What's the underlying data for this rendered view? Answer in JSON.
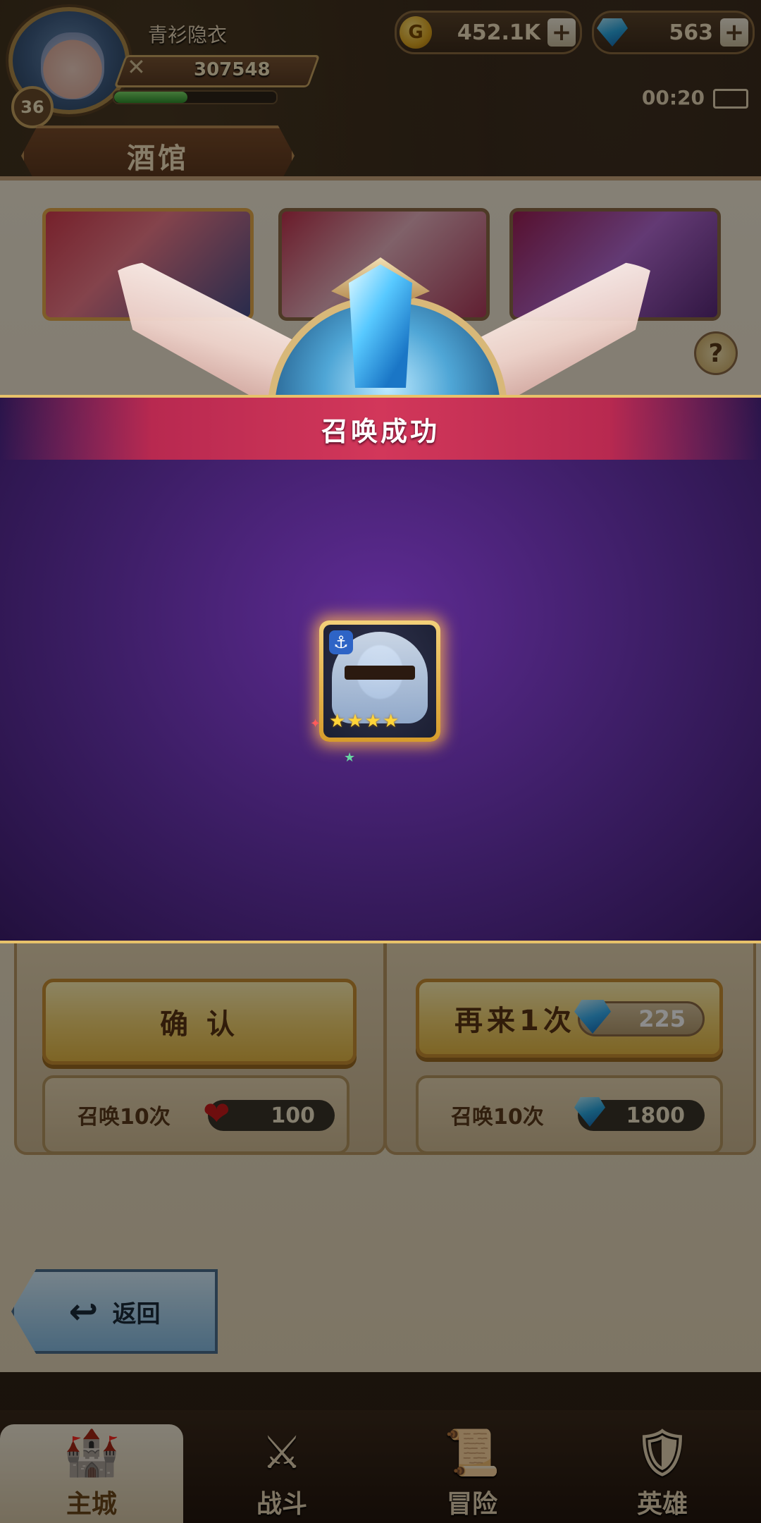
{
  "player": {
    "name": "青衫隐衣",
    "level": "36",
    "power": "307548",
    "xp_fraction": 0.45
  },
  "currency": {
    "gold": "452.1K",
    "gems": "563"
  },
  "status": {
    "time": "00:20"
  },
  "screen": {
    "title": "酒馆"
  },
  "modal": {
    "title": "召唤成功",
    "hero_stars": 4
  },
  "actions": {
    "confirm": "确 认",
    "again": "再来1次",
    "again_cost": "225",
    "summon10_left": "召唤10次",
    "summon10_left_cost": "100",
    "summon10_right": "召唤10次",
    "summon10_right_cost": "1800"
  },
  "back": {
    "label": "返回"
  },
  "nav": [
    {
      "label": "主城",
      "icon": "castle-icon"
    },
    {
      "label": "战斗",
      "icon": "swords-icon"
    },
    {
      "label": "冒险",
      "icon": "scroll-icon"
    },
    {
      "label": "英雄",
      "icon": "crest-icon"
    }
  ],
  "colors": {
    "modal_header": "#d2375a",
    "modal_bg": "#3b1d63",
    "primary": "#f4d473"
  }
}
